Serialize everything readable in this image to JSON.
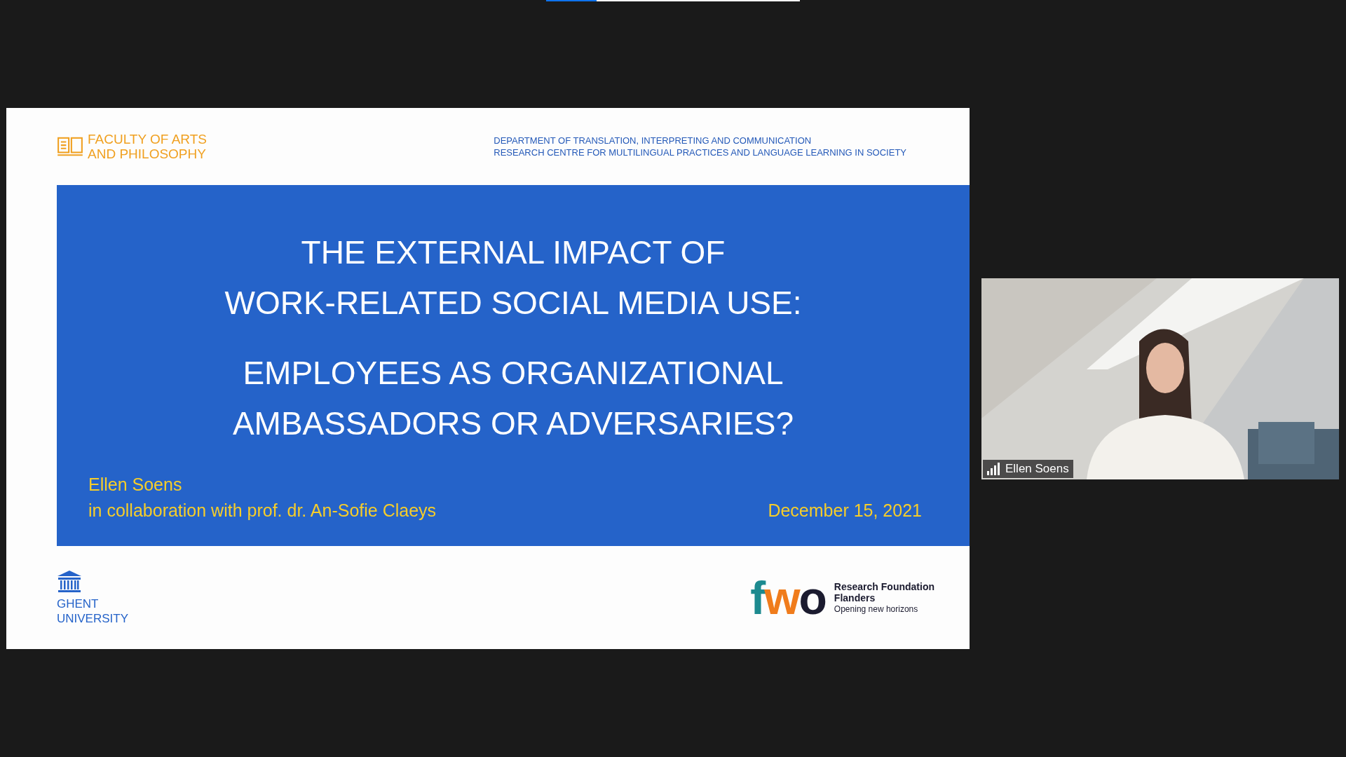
{
  "share_progress": {
    "level": 0.2
  },
  "slide": {
    "header": {
      "faculty": [
        "FACULTY OF ARTS",
        "AND PHILOSOPHY"
      ],
      "department": [
        "DEPARTMENT OF TRANSLATION, INTERPRETING AND COMMUNICATION",
        "RESEARCH CENTRE FOR MULTILINGUAL PRACTICES AND LANGUAGE LEARNING IN SOCIETY"
      ]
    },
    "title": [
      "THE EXTERNAL IMPACT OF",
      "WORK-RELATED SOCIAL MEDIA USE:"
    ],
    "subtitle": [
      "EMPLOYEES AS ORGANIZATIONAL",
      "AMBASSADORS OR ADVERSARIES?"
    ],
    "author": "Ellen Soens",
    "collaboration": "in collaboration with prof. dr. An-Sofie Claeys",
    "date": "December 15, 2021",
    "university": [
      "GHENT",
      "UNIVERSITY"
    ],
    "funder": {
      "logo": "fwo",
      "name": [
        "Research Foundation",
        "Flanders"
      ],
      "tagline": "Opening new horizons"
    }
  },
  "video": {
    "kind": "picture",
    "participant_name": "Ellen Soens"
  }
}
